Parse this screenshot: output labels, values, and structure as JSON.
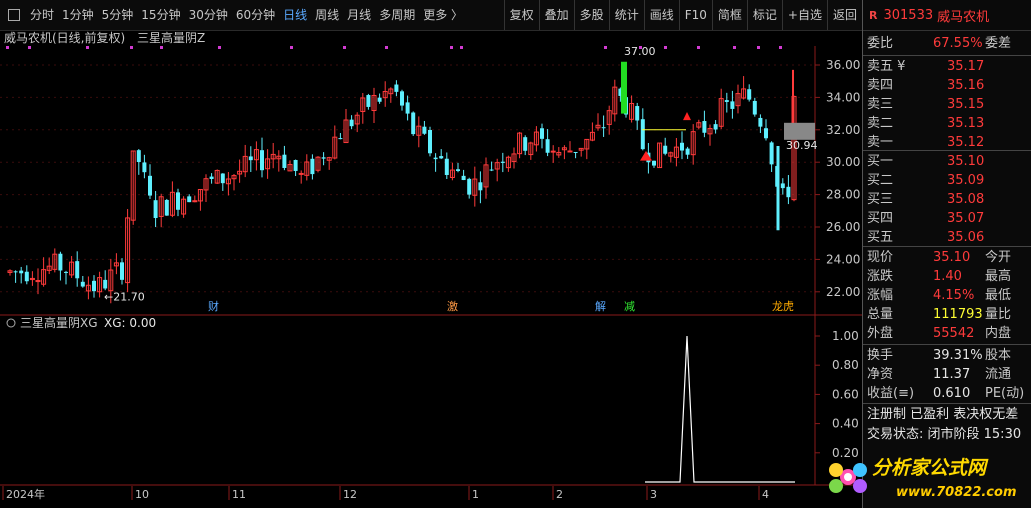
{
  "toolbar": {
    "periods": [
      "分时",
      "1分钟",
      "5分钟",
      "15分钟",
      "30分钟",
      "60分钟",
      "日线",
      "周线",
      "月线",
      "多周期",
      "更多 〉"
    ],
    "active_period": "日线",
    "buttons": [
      "复权",
      "叠加",
      "多股",
      "统计",
      "画线",
      "F10",
      "简框",
      "标记",
      "+自选",
      "返回"
    ]
  },
  "chart": {
    "title": "威马农机(日线,前复权)",
    "indicator": "三星高量阴Z",
    "price_ticks": [
      "36.00",
      "34.00",
      "32.00",
      "30.00",
      "28.00",
      "26.00",
      "24.00",
      "22.00"
    ],
    "high_label": "37.00",
    "low_label": "21.70",
    "current_price_label": "30.94",
    "events": [
      "财",
      "激",
      "解",
      "减",
      "龙虎"
    ]
  },
  "sub_chart": {
    "title": "三星高量阴XG",
    "value_label": "XG: 0.00",
    "ticks": [
      "1.00",
      "0.80",
      "0.60",
      "0.40",
      "0.20"
    ]
  },
  "x_axis": {
    "labels": [
      "2024年",
      "10",
      "11",
      "12",
      "1",
      "2",
      "3",
      "4"
    ]
  },
  "stock": {
    "r_badge": "R",
    "code": "301533",
    "name": "威马农机"
  },
  "quote": {
    "weibi_label": "委比",
    "weibi": "67.55%",
    "weicha_label": "委差",
    "asks": [
      {
        "label": "卖五 ¥",
        "price": "35.17"
      },
      {
        "label": "卖四",
        "price": "35.16"
      },
      {
        "label": "卖三",
        "price": "35.15"
      },
      {
        "label": "卖二",
        "price": "35.13"
      },
      {
        "label": "卖一",
        "price": "35.12"
      }
    ],
    "bids": [
      {
        "label": "买一",
        "price": "35.10"
      },
      {
        "label": "买二",
        "price": "35.09"
      },
      {
        "label": "买三",
        "price": "35.08"
      },
      {
        "label": "买四",
        "price": "35.07"
      },
      {
        "label": "买五",
        "price": "35.06"
      }
    ],
    "stats": [
      {
        "l1": "现价",
        "v": "35.10",
        "l2": "今开"
      },
      {
        "l1": "涨跌",
        "v": "1.40",
        "l2": "最高"
      },
      {
        "l1": "涨幅",
        "v": "4.15%",
        "l2": "最低"
      },
      {
        "l1": "总量",
        "v": "111793",
        "l2": "量比"
      },
      {
        "l1": "外盘",
        "v": "55542",
        "l2": "内盘"
      }
    ],
    "finance": [
      {
        "l1": "换手",
        "v": "39.31%",
        "l2": "股本"
      },
      {
        "l1": "净资",
        "v": "11.37",
        "l2": "流通"
      },
      {
        "l1": "收益(≡)",
        "v": "0.610",
        "l2": "PE(动)"
      }
    ],
    "reg_line": "注册制 已盈利 表决权无差",
    "trade_status": "交易状态: 闭市阶段 15:30"
  },
  "watermark": {
    "text": "分析家公式网",
    "url": "www.70822.com"
  },
  "colors": {
    "up": "#ff3b3b",
    "down": "#5ff0ff",
    "accent": "#5aa9ff",
    "grid": "#7a1a1a",
    "markers": "#d23bd2"
  }
}
